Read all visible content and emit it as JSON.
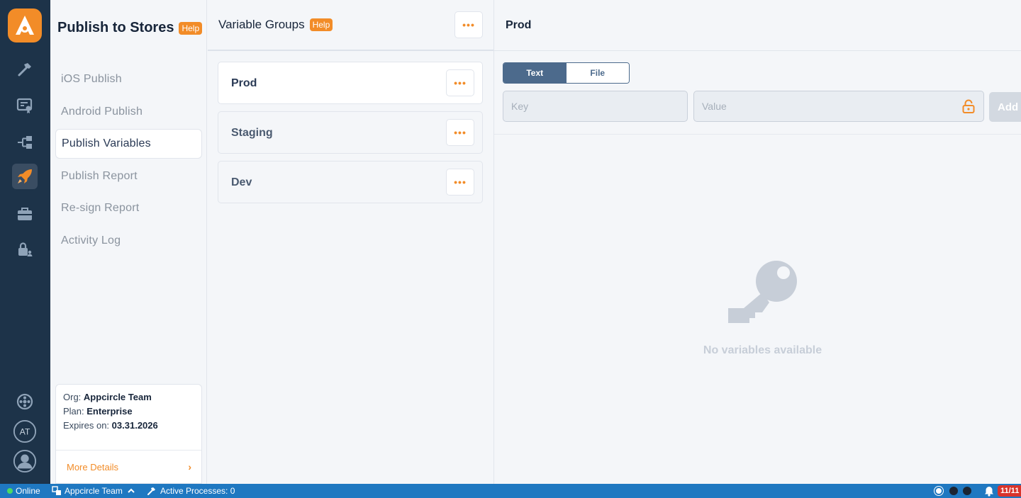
{
  "sidebar": {
    "title": "Publish to Stores",
    "help_label": "Help",
    "items": [
      {
        "label": "iOS Publish"
      },
      {
        "label": "Android Publish"
      },
      {
        "label": "Publish Variables"
      },
      {
        "label": "Publish Report"
      },
      {
        "label": "Re-sign Report"
      },
      {
        "label": "Activity Log"
      }
    ],
    "active_index": 2,
    "org": {
      "org_label": "Org:",
      "org_value": "Appcircle Team",
      "plan_label": "Plan:",
      "plan_value": "Enterprise",
      "expires_label": "Expires on:",
      "expires_value": "03.31.2026",
      "more_label": "More Details"
    }
  },
  "groups": {
    "title": "Variable Groups",
    "help_label": "Help",
    "items": [
      {
        "name": "Prod"
      },
      {
        "name": "Staging"
      },
      {
        "name": "Dev"
      }
    ],
    "active_index": 0
  },
  "detail": {
    "title": "Prod",
    "tabs": [
      {
        "label": "Text"
      },
      {
        "label": "File"
      }
    ],
    "active_tab": 0,
    "key_placeholder": "Key",
    "value_placeholder": "Value",
    "add_label": "Add",
    "empty_text": "No variables available"
  },
  "status_bar": {
    "online_label": "Online",
    "team_label": "Appcircle Team",
    "processes_label": "Active Processes: 0",
    "badge": "11/11"
  },
  "colors": {
    "accent": "#f28c28",
    "rail": "#1d3349",
    "status_bar": "#1f78c1",
    "segment": "#4c6a8c"
  }
}
